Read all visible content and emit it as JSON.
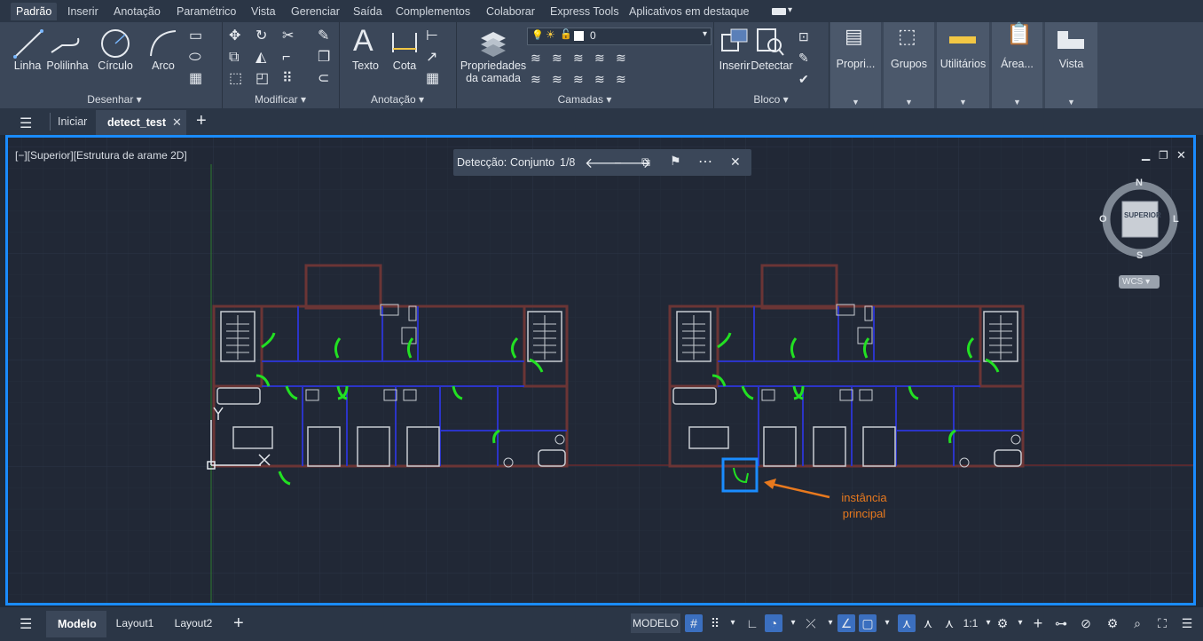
{
  "ribbon_tabs": [
    "Padrão",
    "Inserir",
    "Anotação",
    "Paramétrico",
    "Vista",
    "Gerenciar",
    "Saída",
    "Complementos",
    "Colaborar",
    "Express Tools",
    "Aplicativos em destaque"
  ],
  "draw": {
    "linha": "Linha",
    "polilinha": "Polilinha",
    "circulo": "Círculo",
    "arco": "Arco",
    "title": "Desenhar ▾"
  },
  "modify": {
    "title": "Modificar ▾"
  },
  "annotation": {
    "texto": "Texto",
    "cota": "Cota",
    "title": "Anotação ▾"
  },
  "layers": {
    "props": "Propriedades da camada",
    "current": "0",
    "title": "Camadas ▾"
  },
  "block": {
    "inserir": "Inserir",
    "detectar": "Detectar",
    "title": "Bloco ▾"
  },
  "right_panels": {
    "propri": "Propri...",
    "grupos": "Grupos",
    "utilitarios": "Utilitários",
    "area": "Área...",
    "vista": "Vista"
  },
  "file_tabs": {
    "home": "Iniciar",
    "current": "detect_test"
  },
  "viewport": {
    "label": "[−][Superior][Estrutura de arame 2D]"
  },
  "detection": {
    "label": "Detecção:",
    "set": "Conjunto",
    "count": "1/8"
  },
  "viewcube": {
    "n": "N",
    "s": "S",
    "o": "O",
    "l": "L",
    "face": "SUPERIOR",
    "wcs": "WCS"
  },
  "callout": {
    "line1": "instância",
    "line2": "principal"
  },
  "ucs": {
    "x": "X",
    "y": "Y"
  },
  "status": {
    "model_tab": "Modelo",
    "layout1": "Layout1",
    "layout2": "Layout2",
    "model_btn": "MODELO",
    "scale": "1:1"
  },
  "colors": {
    "accent": "#1a8cff",
    "door": "#22e022",
    "wall_blue": "#2b34c8",
    "wall_dark": "#5a2a2a",
    "callout": "#e8791e"
  }
}
